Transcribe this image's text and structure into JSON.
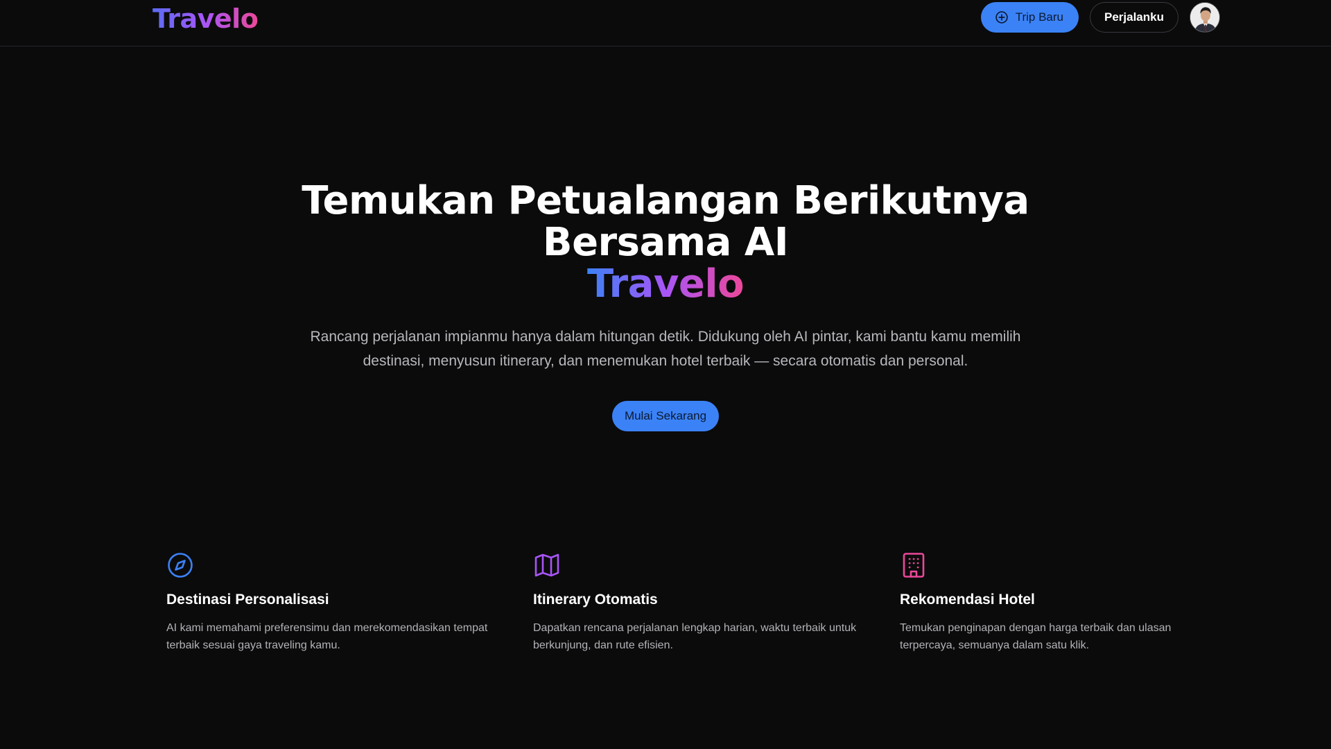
{
  "header": {
    "logo": "Travelo",
    "trip_button": "Trip Baru",
    "perjalanku_button": "Perjalanku"
  },
  "hero": {
    "title_line1": "Temukan Petualangan Berikutnya",
    "title_line2": "Bersama AI",
    "brand": "Travelo",
    "subtitle": "Rancang perjalanan impianmu hanya dalam hitungan detik. Didukung oleh AI pintar, kami bantu kamu memilih destinasi, menyusun itinerary, dan menemukan hotel terbaik — secara otomatis dan personal.",
    "cta": "Mulai Sekarang"
  },
  "features": [
    {
      "icon": "compass-icon",
      "color": "#3b82f6",
      "title": "Destinasi Personalisasi",
      "desc": "AI kami memahami preferensimu dan merekomendasikan tempat terbaik sesuai gaya traveling kamu."
    },
    {
      "icon": "map-icon",
      "color": "#a855f7",
      "title": "Itinerary Otomatis",
      "desc": "Dapatkan rencana perjalanan lengkap harian, waktu terbaik untuk berkunjung, dan rute efisien."
    },
    {
      "icon": "building-icon",
      "color": "#ec4899",
      "title": "Rekomendasi Hotel",
      "desc": "Temukan penginapan dengan harga terbaik dan ulasan terpercaya, semuanya dalam satu klik."
    }
  ],
  "colors": {
    "background": "#0b0b0c",
    "accent_blue": "#3b82f6",
    "accent_purple": "#a855f7",
    "accent_pink": "#ec4899"
  }
}
